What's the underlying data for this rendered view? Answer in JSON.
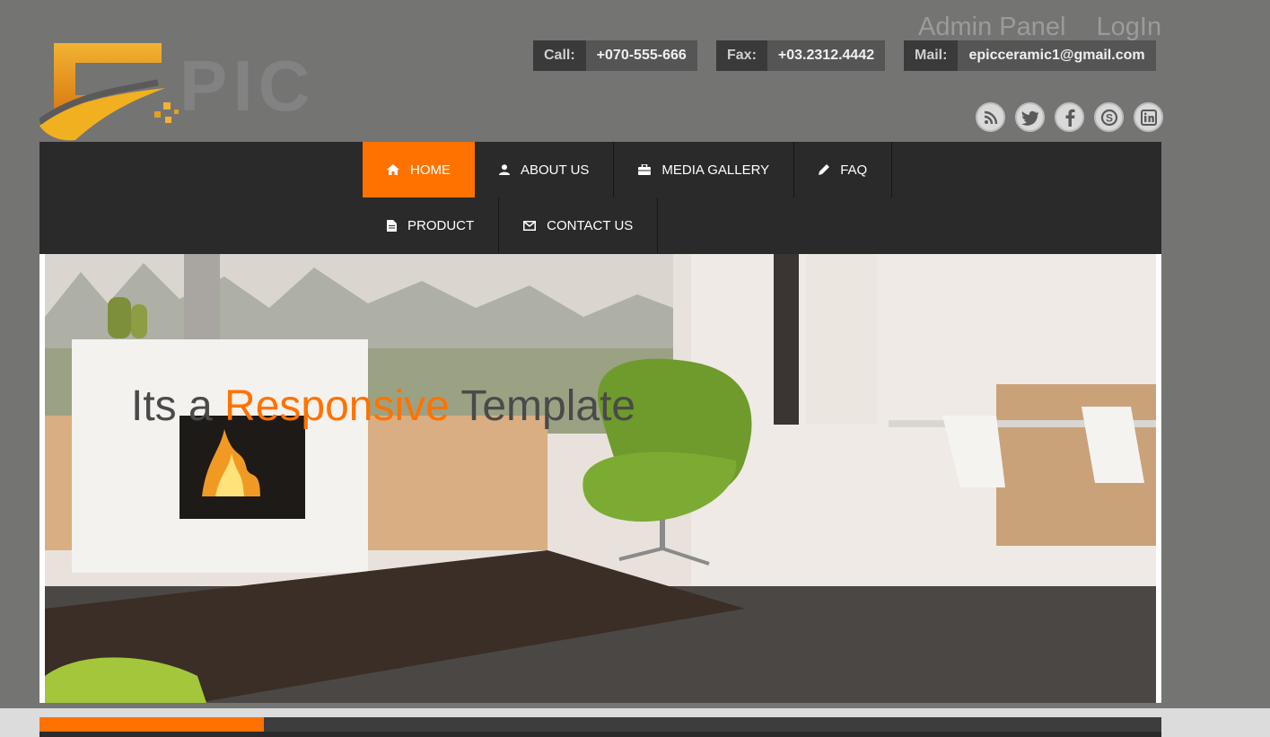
{
  "top_links": {
    "admin": "Admin Panel",
    "login": "LogIn"
  },
  "logo": {
    "text": "PIC"
  },
  "contact": [
    {
      "label": "Call:",
      "value": "+070-555-666"
    },
    {
      "label": "Fax:",
      "value": "+03.2312.4442"
    },
    {
      "label": "Mail:",
      "value": "epicceramic1@gmail.com"
    }
  ],
  "social": [
    "rss-icon",
    "twitter-icon",
    "facebook-icon",
    "skype-icon",
    "linkedin-icon"
  ],
  "nav": [
    {
      "label": "HOME",
      "icon": "home-icon",
      "active": true
    },
    {
      "label": "ABOUT US",
      "icon": "user-icon"
    },
    {
      "label": "MEDIA GALLERY",
      "icon": "briefcase-icon"
    },
    {
      "label": "FAQ",
      "icon": "pencil-icon"
    },
    {
      "label": "PRODUCT",
      "icon": "document-icon"
    },
    {
      "label": "CONTACT US",
      "icon": "envelope-icon"
    }
  ],
  "hero": {
    "text_before": "Its a ",
    "highlight": "Responsive",
    "text_after": " Template"
  },
  "colors": {
    "accent": "#ff7200",
    "nav_bg": "#2a2a2a",
    "page_bg": "#747473"
  }
}
